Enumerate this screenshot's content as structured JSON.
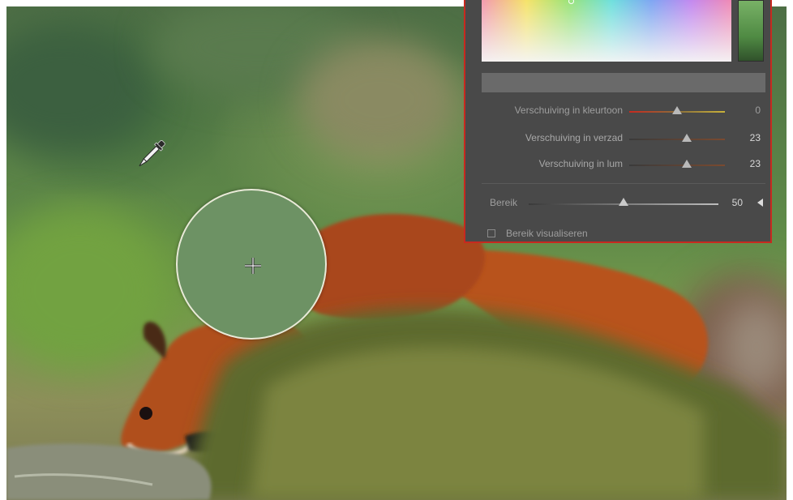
{
  "color_panel": {
    "sliders": [
      {
        "label": "Verschuiving in kleurtoon",
        "value": "0",
        "level": 0.5
      },
      {
        "label": "Verschuiving in verzad",
        "value": "23",
        "level": 0.6
      },
      {
        "label": "Verschuiving in lum",
        "value": "23",
        "level": 0.6
      }
    ],
    "range": {
      "label": "Bereik",
      "value": "50",
      "level": 0.5
    },
    "visualize": {
      "label": "Bereik visualiseren",
      "checked": false
    },
    "border_color": "#c8291f",
    "sampled_color": "#6d9264"
  },
  "tools": {
    "eyedropper": "eyedropper-icon",
    "crosshair": "crosshair-icon"
  }
}
